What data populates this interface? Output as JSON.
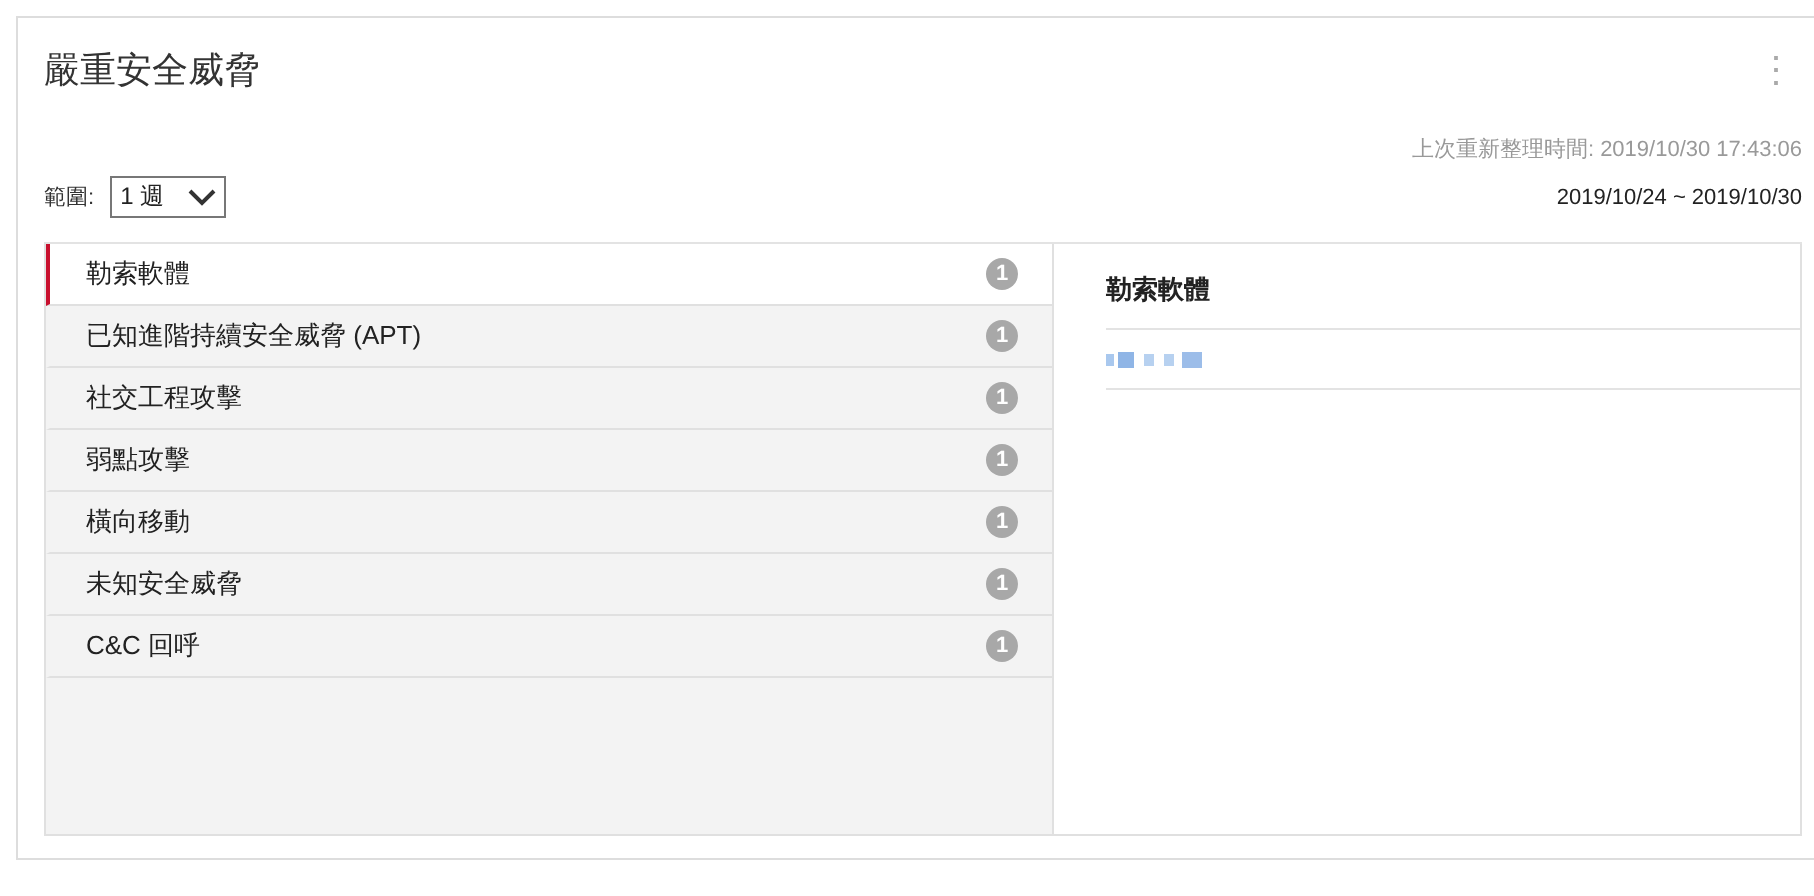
{
  "widget": {
    "title": "嚴重安全威脅",
    "menu_icon": "⋮"
  },
  "range": {
    "label": "範圍:",
    "value": "1 週"
  },
  "last_refresh": "上次重新整理時間: 2019/10/30 17:43:06",
  "date_range": "2019/10/24 ~ 2019/10/30",
  "categories": [
    {
      "label": "勒索軟體",
      "count": "1",
      "selected": true
    },
    {
      "label": "已知進階持續安全威脅 (APT)",
      "count": "1",
      "selected": false
    },
    {
      "label": "社交工程攻擊",
      "count": "1",
      "selected": false
    },
    {
      "label": "弱點攻擊",
      "count": "1",
      "selected": false
    },
    {
      "label": "橫向移動",
      "count": "1",
      "selected": false
    },
    {
      "label": "未知安全威脅",
      "count": "1",
      "selected": false
    },
    {
      "label": "C&C 回呼",
      "count": "1",
      "selected": false
    }
  ],
  "detail": {
    "title": "勒索軟體"
  }
}
